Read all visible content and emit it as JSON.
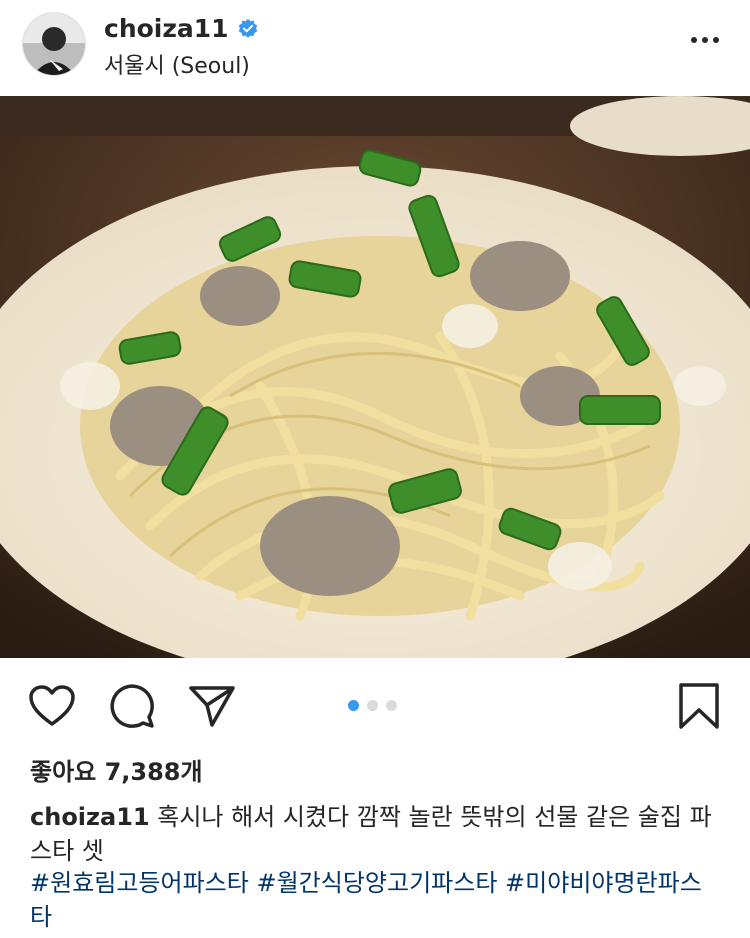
{
  "header": {
    "username": "choiza11",
    "location": "서울시 (Seoul)"
  },
  "engagement": {
    "likes": "좋아요 7,388개",
    "carousel_total": 3,
    "carousel_active": 0
  },
  "caption": {
    "username": "choiza11",
    "text": "혹시나 해서 시켰다 깜짝 놀란 뜻밖의 선물 같은 술집 파스타 셋"
  },
  "hashtags": [
    "#원효림고등어파스타",
    "#월간식당양고기파스타",
    "#미야비야명란파스타"
  ],
  "colors": {
    "verified": "#3897f0",
    "hashtag": "#003569",
    "active_dot": "#3897f0"
  }
}
